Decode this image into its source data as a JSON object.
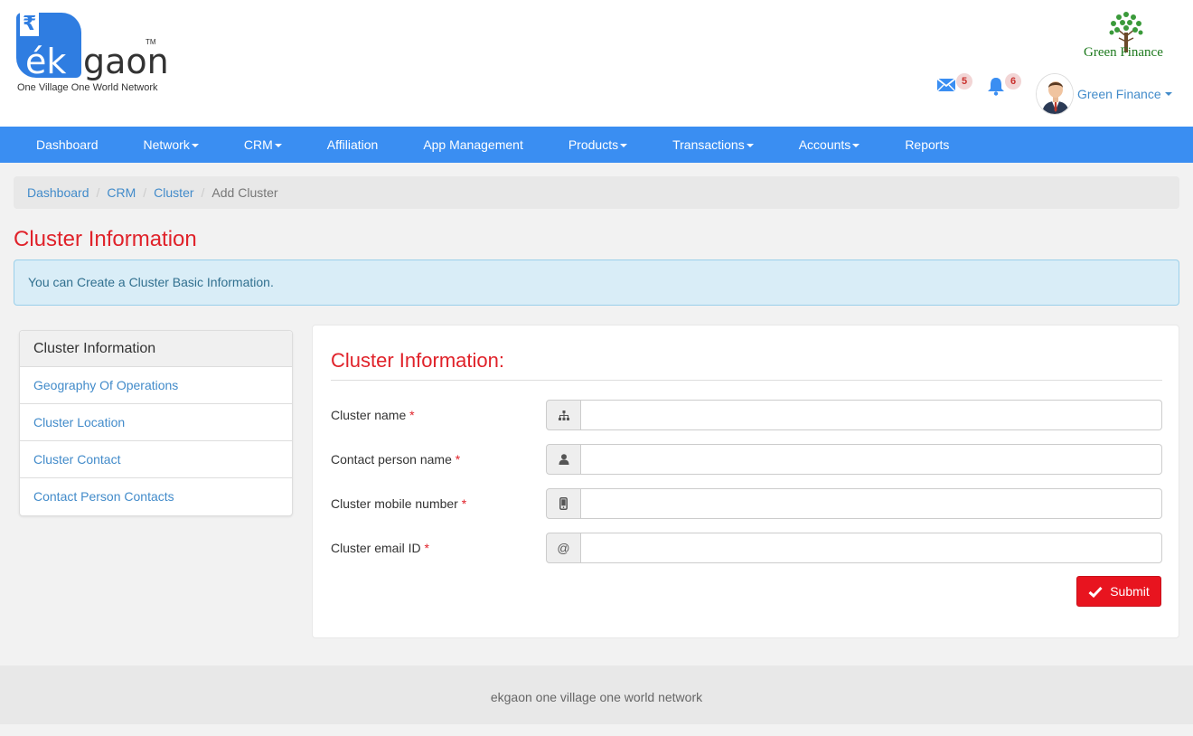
{
  "brand": {
    "rupee_symbol": "₹",
    "logo_ek": "ék",
    "logo_gaon": "gaon",
    "logo_tm": "TM",
    "tagline": "One Village One World Network",
    "partner_logo_text": "Green Finance",
    "primary_color": "#3a8ef2",
    "accent_color": "#e0222a"
  },
  "header": {
    "mail_badge": "5",
    "bell_badge": "6",
    "user_name": "Green Finance"
  },
  "nav": {
    "items": [
      {
        "label": "Dashboard",
        "dropdown": false
      },
      {
        "label": "Network",
        "dropdown": true
      },
      {
        "label": "CRM",
        "dropdown": true
      },
      {
        "label": "Affiliation",
        "dropdown": false
      },
      {
        "label": "App Management",
        "dropdown": false
      },
      {
        "label": "Products",
        "dropdown": true
      },
      {
        "label": "Transactions",
        "dropdown": true
      },
      {
        "label": "Accounts",
        "dropdown": true
      },
      {
        "label": "Reports",
        "dropdown": false
      }
    ]
  },
  "breadcrumb": {
    "items": [
      "Dashboard",
      "CRM",
      "Cluster"
    ],
    "separator": "/",
    "active": "Add Cluster"
  },
  "page": {
    "title": "Cluster Information",
    "alert": "You can Create a Cluster Basic Information."
  },
  "sidebar": {
    "heading": "Cluster Information",
    "items": [
      "Geography Of Operations",
      "Cluster Location",
      "Cluster Contact",
      "Contact Person Contacts"
    ]
  },
  "form": {
    "title": "Cluster Information:",
    "required_mark": "*",
    "fields": [
      {
        "label": "Cluster name",
        "icon": "sitemap-icon",
        "value": ""
      },
      {
        "label": "Contact person name",
        "icon": "user-icon",
        "value": ""
      },
      {
        "label": "Cluster mobile number",
        "icon": "mobile-icon",
        "value": ""
      },
      {
        "label": "Cluster email ID",
        "icon": "at-icon",
        "value": "",
        "addon_text": "@"
      }
    ],
    "submit_label": "Submit"
  },
  "footer": {
    "text": "ekgaon one village one world network"
  }
}
